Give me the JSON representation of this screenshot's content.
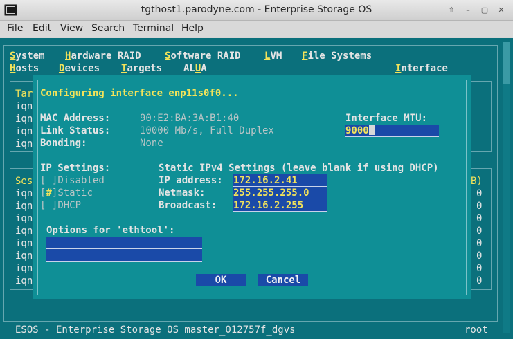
{
  "window": {
    "title": "tgthost1.parodyne.com - Enterprise Storage OS",
    "buttons": [
      "⇧",
      "–",
      "▢",
      "✕"
    ]
  },
  "menubar": {
    "items": [
      "File",
      "Edit",
      "View",
      "Search",
      "Terminal",
      "Help"
    ]
  },
  "app_menu": {
    "row1": [
      {
        "hotkey": "S",
        "rest": "ystem"
      },
      {
        "pre": "H",
        "hotkey": "a",
        "rest": "rdware RAID",
        "raw": "Hardware RAID"
      },
      {
        "pre": "S",
        "hotkey": "o",
        "rest": "ftware RAID"
      },
      {
        "hotkey": "L",
        "rest": "VM"
      },
      {
        "hotkey": "F",
        "rest": "ile Systems"
      }
    ],
    "row2": [
      {
        "hotkey": "H",
        "rest": "osts"
      },
      {
        "hotkey": "D",
        "rest": "evices"
      },
      {
        "hotkey": "T",
        "rest": "argets"
      },
      {
        "pre": "AL",
        "hotkey": "U",
        "rest": "A"
      },
      {
        "hotkey": "I",
        "rest": "nterface"
      }
    ]
  },
  "background": {
    "targets_header": "Tar",
    "targets_rows": [
      "iqn",
      "iqn",
      "iqn",
      "iqn"
    ],
    "sessions_header": "Ses",
    "sessions_header_right": "B)",
    "sessions_rows": [
      "iqn",
      "iqn",
      "iqn",
      "iqn",
      "iqn",
      "iqn",
      "iqn",
      "iqn"
    ],
    "sessions_right_values": [
      "0",
      "0",
      "0",
      "0",
      "0",
      "0",
      "0",
      "0"
    ]
  },
  "dialog": {
    "title": "Configuring interface enp11s0f0...",
    "mac_label": "MAC Address:",
    "mac_value": "90:E2:BA:3A:B1:40",
    "link_label": "Link Status:",
    "link_value": "10000 Mb/s, Full Duplex",
    "bonding_label": "Bonding:",
    "bonding_value": "None",
    "mtu_label": "Interface MTU:",
    "mtu_value": "9000",
    "ip_settings_label": "IP Settings:",
    "static_settings_label": "Static IPv4 Settings (leave blank if using DHCP)",
    "options": [
      {
        "mark": " ",
        "label": "Disabled"
      },
      {
        "mark": "#",
        "label": "Static"
      },
      {
        "mark": " ",
        "label": "DHCP"
      }
    ],
    "ip_label": "IP address:",
    "ip_value": "172.16.2.41",
    "netmask_label": "Netmask:",
    "netmask_value": "255.255.255.0",
    "broadcast_label": "Broadcast:",
    "broadcast_value": "172.16.2.255",
    "ethtool_label": "Options for 'ethtool':",
    "ethtool_value1": "",
    "ethtool_value2": "",
    "ok_label": "OK",
    "cancel_label": "Cancel"
  },
  "statusbar": {
    "left": "ESOS - Enterprise Storage OS master_012757f_dgvs",
    "right": "root"
  },
  "colors": {
    "terminal_bg": "#0b707c",
    "dialog_bg": "#0f8f96",
    "field_bg": "#1a4aa8",
    "hotkey": "#f3e35a"
  }
}
